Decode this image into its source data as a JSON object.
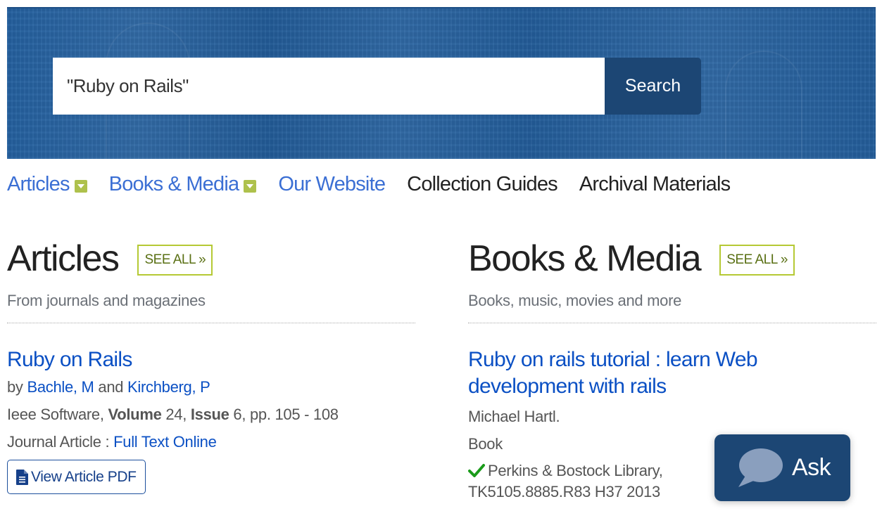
{
  "search": {
    "query": "\"Ruby on Rails\"",
    "button_label": "Search"
  },
  "nav": {
    "items": [
      {
        "label": "Articles",
        "has_dropdown": true
      },
      {
        "label": "Books & Media",
        "has_dropdown": true
      },
      {
        "label": "Our Website",
        "has_dropdown": false
      },
      {
        "label": "Collection Guides",
        "has_dropdown": false
      },
      {
        "label": "Archival Materials",
        "has_dropdown": false
      }
    ]
  },
  "articles": {
    "title": "Articles",
    "see_all": "SEE ALL »",
    "subtitle": "From journals and magazines",
    "results": [
      {
        "title": "Ruby on Rails",
        "by_prefix": "by",
        "authors": [
          "Bachle, M",
          "Kirchberg, P"
        ],
        "author_joiner": "and",
        "source": "Ieee Software,",
        "volume_label": "Volume",
        "volume": "24,",
        "issue_label": "Issue",
        "issue_pages": "6, pp. 105 - 108",
        "type": "Journal Article :",
        "access_link": "Full Text Online",
        "pdf_button": "View Article PDF"
      }
    ]
  },
  "books": {
    "title": "Books & Media",
    "see_all": "SEE ALL »",
    "subtitle": "Books, music, movies and more",
    "results": [
      {
        "title": "Ruby on rails tutorial : learn Web development with rails",
        "author": "Michael Hartl.",
        "format": "Book",
        "availability_status": "available",
        "location": "Perkins & Bostock Library,",
        "call_number": "TK5105.8885.R83 H37 2013"
      }
    ]
  },
  "ask_widget": {
    "label": "Ask"
  },
  "colors": {
    "banner": "#24609f",
    "search_button": "#1c4674",
    "nav_link": "#3b6fd4",
    "result_link": "#0b50c4",
    "see_all_border": "#b5c934",
    "dropdown_caret": "#aec14c",
    "available_check": "#1a9b1a"
  }
}
